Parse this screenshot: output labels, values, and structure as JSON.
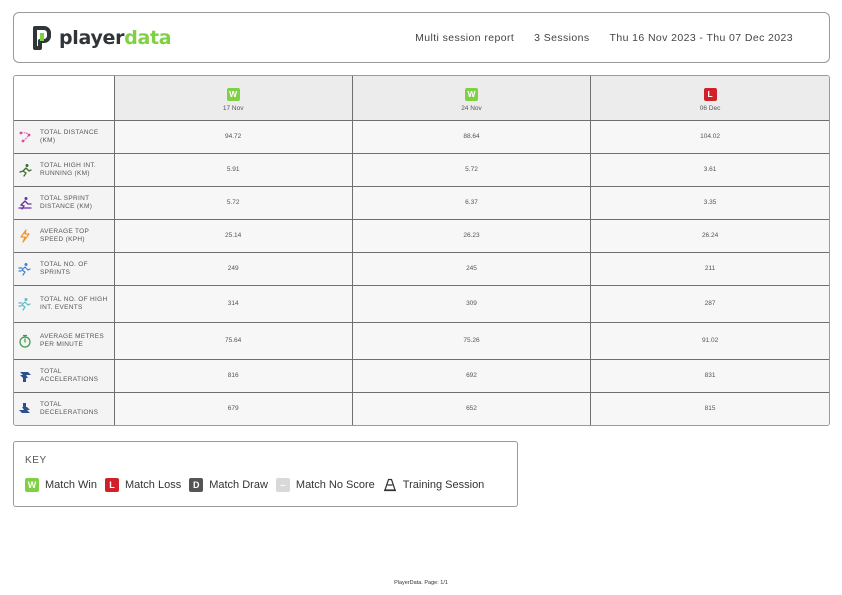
{
  "header": {
    "brand": {
      "part1": "player",
      "part2": "data"
    },
    "report_type": "Multi session report",
    "session_count": "3 Sessions",
    "date_range": "Thu 16 Nov 2023 - Thu 07 Dec 2023"
  },
  "colors": {
    "win": "#7fd042",
    "loss": "#d0212b",
    "draw": "#555555",
    "no_score": "#d9d9d9"
  },
  "sessions": [
    {
      "result": "W",
      "date": "17 Nov"
    },
    {
      "result": "W",
      "date": "24 Nov"
    },
    {
      "result": "L",
      "date": "06 Dec"
    }
  ],
  "metrics": [
    {
      "icon": "distance-icon",
      "label": "TOTAL DISTANCE (KM)",
      "values": [
        "94.72",
        "88.64",
        "104.02"
      ]
    },
    {
      "icon": "high-intensity-running-icon",
      "label": "TOTAL HIGH INT. RUNNING (KM)",
      "values": [
        "5.91",
        "5.72",
        "3.61"
      ]
    },
    {
      "icon": "sprint-distance-icon",
      "label": "TOTAL SPRINT DISTANCE (KM)",
      "values": [
        "5.72",
        "6.37",
        "3.35"
      ]
    },
    {
      "icon": "top-speed-icon",
      "label": "AVERAGE TOP SPEED (KPH)",
      "values": [
        "25.14",
        "26.23",
        "26.24"
      ]
    },
    {
      "icon": "sprints-icon",
      "label": "TOTAL NO. OF SPRINTS",
      "values": [
        "249",
        "245",
        "211"
      ]
    },
    {
      "icon": "high-int-events-icon",
      "label": "TOTAL NO. OF HIGH INT. EVENTS",
      "values": [
        "314",
        "309",
        "287"
      ]
    },
    {
      "icon": "stopwatch-icon",
      "label": "AVERAGE METRES PER MINUTE",
      "values": [
        "75.64",
        "75.26",
        "91.02"
      ]
    },
    {
      "icon": "accelerations-icon",
      "label": "TOTAL ACCELERATIONS",
      "values": [
        "816",
        "692",
        "831"
      ]
    },
    {
      "icon": "decelerations-icon",
      "label": "TOTAL DECELERATIONS",
      "values": [
        "679",
        "652",
        "815"
      ]
    }
  ],
  "key": {
    "title": "KEY",
    "items": [
      {
        "badge": "W",
        "label": "Match Win"
      },
      {
        "badge": "L",
        "label": "Match Loss"
      },
      {
        "badge": "D",
        "label": "Match Draw"
      },
      {
        "badge": "–",
        "label": "Match No Score"
      },
      {
        "badge": "",
        "label": "Training Session"
      }
    ]
  },
  "footer": "PlayerData. Page: 1/1"
}
